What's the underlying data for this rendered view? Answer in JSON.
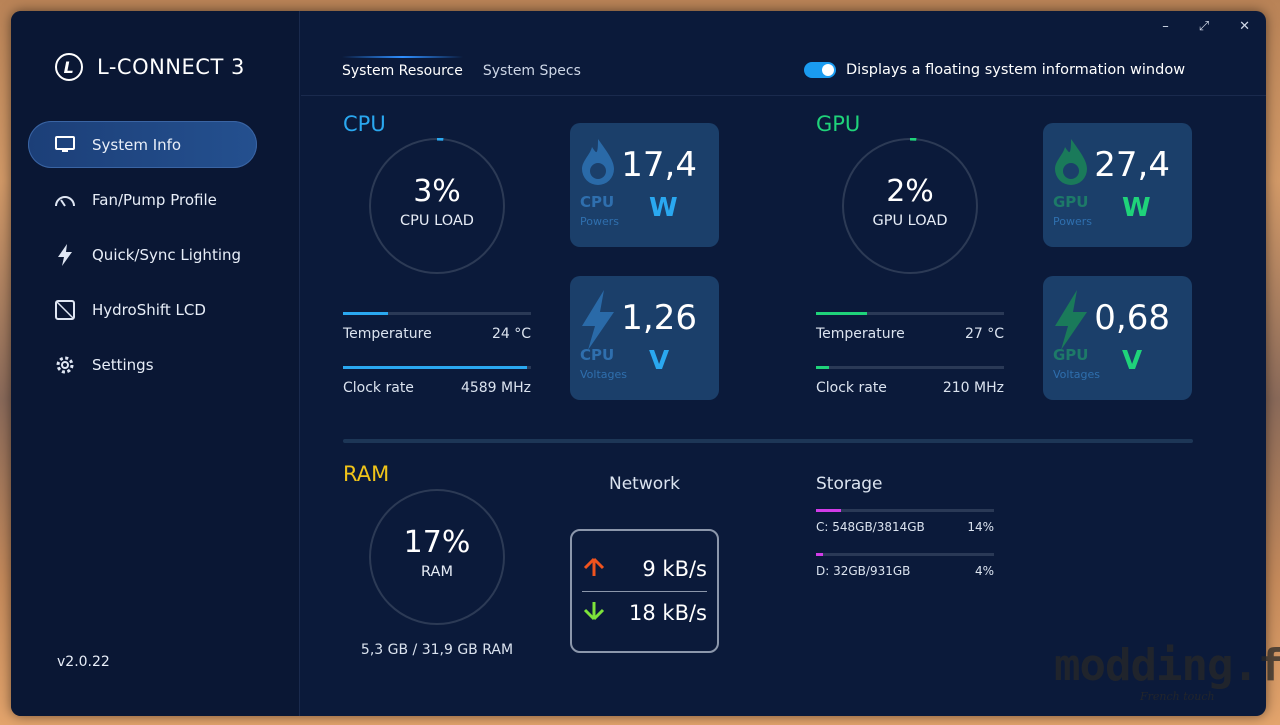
{
  "app": {
    "title": "L-CONNECT 3",
    "logo_letter": "L",
    "version": "v2.0.22"
  },
  "window_controls": {
    "minimize": "–",
    "maximize": "⤢",
    "close": "✕"
  },
  "sidebar": {
    "items": [
      {
        "label": "System Info",
        "icon": "monitor-icon",
        "active": true
      },
      {
        "label": "Fan/Pump Profile",
        "icon": "gauge-icon"
      },
      {
        "label": "Quick/Sync Lighting",
        "icon": "lightning-icon"
      },
      {
        "label": "HydroShift LCD",
        "icon": "lcd-icon"
      },
      {
        "label": "Settings",
        "icon": "gear-icon"
      }
    ]
  },
  "tabs": [
    {
      "label": "System Resource",
      "active": true
    },
    {
      "label": "System Specs"
    }
  ],
  "floating_toggle": {
    "label": "Displays a floating system information window",
    "on": true
  },
  "cpu": {
    "title": "CPU",
    "color": "#2aa8f0",
    "load": "3%",
    "load_label": "CPU LOAD",
    "load_fraction": 0.03,
    "power": {
      "value": "17,4",
      "unit": "W",
      "kind": "CPU",
      "sub": "Powers"
    },
    "voltage": {
      "value": "1,26",
      "unit": "V",
      "kind": "CPU",
      "sub": "Voltages"
    },
    "temperature": {
      "label": "Temperature",
      "value": "24 °C",
      "fraction": 0.24
    },
    "clock": {
      "label": "Clock rate",
      "value": "4589 MHz",
      "fraction": 0.98
    }
  },
  "gpu": {
    "title": "GPU",
    "color": "#1fd37a",
    "load": "2%",
    "load_label": "GPU LOAD",
    "load_fraction": 0.02,
    "power": {
      "value": "27,4",
      "unit": "W",
      "kind": "GPU",
      "sub": "Powers"
    },
    "voltage": {
      "value": "0,68",
      "unit": "V",
      "kind": "GPU",
      "sub": "Voltages"
    },
    "temperature": {
      "label": "Temperature",
      "value": "27 °C",
      "fraction": 0.27
    },
    "clock": {
      "label": "Clock rate",
      "value": "210 MHz",
      "fraction": 0.07
    }
  },
  "ram": {
    "title": "RAM",
    "color": "#f0c419",
    "load": "17%",
    "load_label": "RAM",
    "load_fraction": 0.17,
    "usage": "5,3 GB / 31,9 GB RAM"
  },
  "network": {
    "title": "Network",
    "upload": "9 kB/s",
    "download": "18 kB/s",
    "up_color": "#f0531e",
    "down_color": "#7de33a"
  },
  "storage": {
    "title": "Storage",
    "drives": [
      {
        "label": "C: 548GB/3814GB",
        "percent": "14%",
        "fraction": 0.14
      },
      {
        "label": "D: 32GB/931GB",
        "percent": "4%",
        "fraction": 0.04
      }
    ]
  },
  "watermark": {
    "main": "modding.fr",
    "sub": "French touch"
  }
}
